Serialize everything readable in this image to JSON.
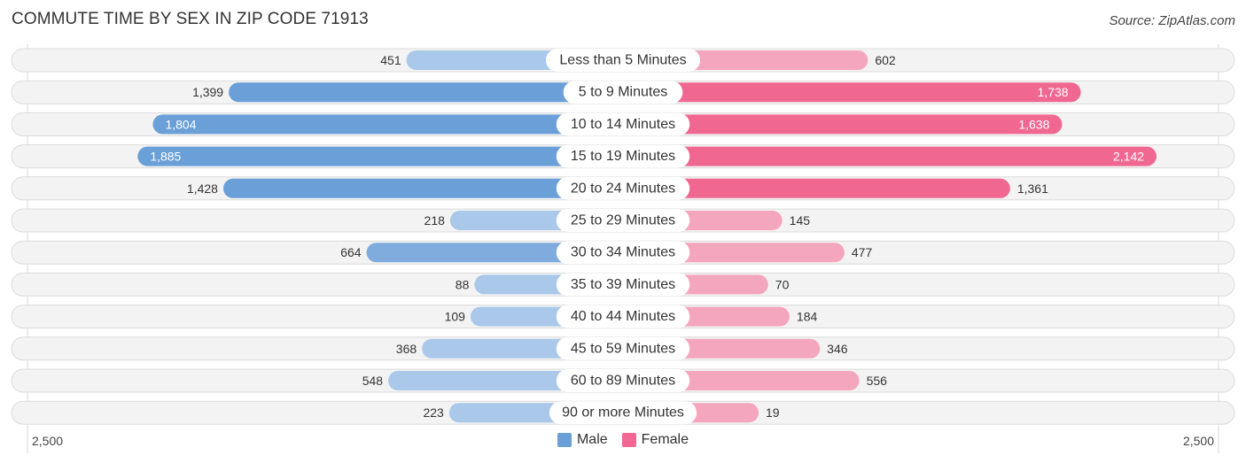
{
  "title": "COMMUTE TIME BY SEX IN ZIP CODE 71913",
  "source": "Source: ZipAtlas.com",
  "colors": {
    "male": "#6a9fd8",
    "male_light": "#a9c8ea",
    "female": "#f06892",
    "female_light": "#f5a6bf"
  },
  "legend": [
    {
      "key": "male",
      "label": "Male"
    },
    {
      "key": "female",
      "label": "Female"
    }
  ],
  "chart_data": {
    "type": "bar",
    "orientation": "horizontal-diverging",
    "title": "COMMUTE TIME BY SEX IN ZIP CODE 71913",
    "categories": [
      "Less than 5 Minutes",
      "5 to 9 Minutes",
      "10 to 14 Minutes",
      "15 to 19 Minutes",
      "20 to 24 Minutes",
      "25 to 29 Minutes",
      "30 to 34 Minutes",
      "35 to 39 Minutes",
      "40 to 44 Minutes",
      "45 to 59 Minutes",
      "60 to 89 Minutes",
      "90 or more Minutes"
    ],
    "series": [
      {
        "name": "Male",
        "values": [
          451,
          1399,
          1804,
          1885,
          1428,
          218,
          664,
          88,
          109,
          368,
          548,
          223
        ]
      },
      {
        "name": "Female",
        "values": [
          602,
          1738,
          1638,
          2142,
          1361,
          145,
          477,
          70,
          184,
          346,
          556,
          19
        ]
      }
    ],
    "value_labels": {
      "male": [
        "451",
        "1,399",
        "1,804",
        "1,885",
        "1,428",
        "218",
        "664",
        "88",
        "109",
        "368",
        "548",
        "223"
      ],
      "female": [
        "602",
        "1,738",
        "1,638",
        "2,142",
        "1,361",
        "145",
        "477",
        "70",
        "184",
        "346",
        "556",
        "19"
      ]
    },
    "axis": {
      "left_label": "2,500",
      "right_label": "2,500",
      "range": [
        0,
        2500
      ]
    },
    "legend_position": "bottom-center"
  }
}
